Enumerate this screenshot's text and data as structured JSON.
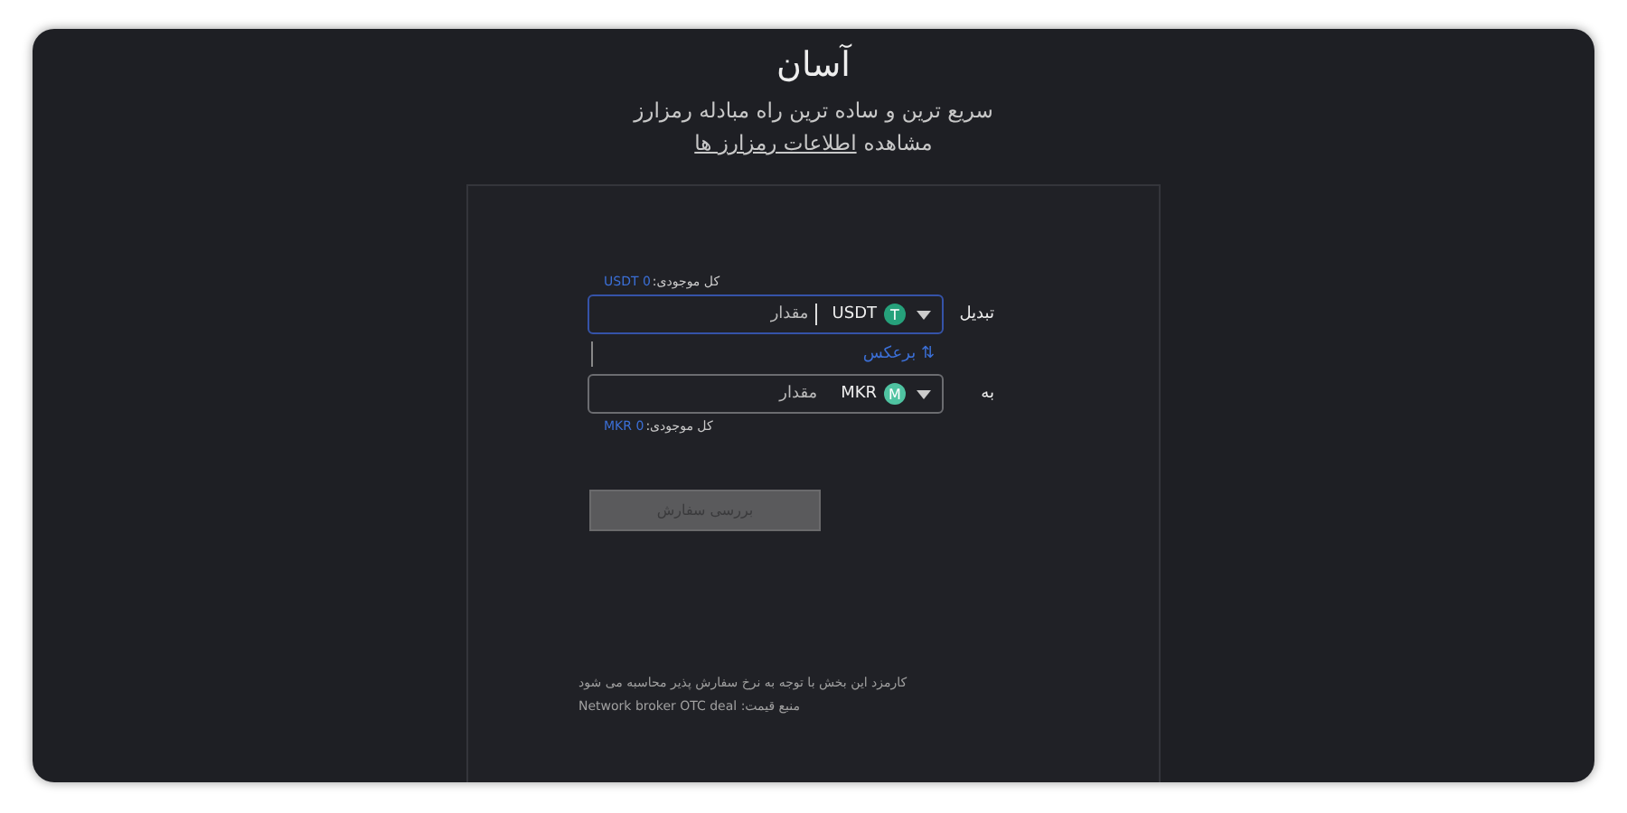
{
  "header": {
    "title": "آسان",
    "subtitle": "سریع ترین و ساده ترین راه مبادله رمزارز",
    "info_prefix": "مشاهده",
    "info_link": "اطلاعات رمزارز ها"
  },
  "from": {
    "balance_label": "کل موجودی:",
    "balance_value": "USDT 0",
    "label": "تبدیل",
    "token": "USDT",
    "token_letter": "T",
    "color": "#26a17b",
    "placeholder": "مقدار",
    "focused": true
  },
  "swap": {
    "icon": "⇅",
    "label": "برعکس"
  },
  "to": {
    "balance_label": "کل موجودی:",
    "balance_value": "MKR 0",
    "label": "به",
    "token": "MKR",
    "token_letter": "M",
    "color": "#4fc3a1",
    "placeholder": "مقدار",
    "focused": false
  },
  "submit": {
    "label": "بررسی سفارش",
    "disabled": true
  },
  "notes": [
    "کارمزد این بخش با توجه به نرخ سفارش پذیر محاسبه می شود",
    "منبع قیمت: Network broker OTC deal"
  ]
}
